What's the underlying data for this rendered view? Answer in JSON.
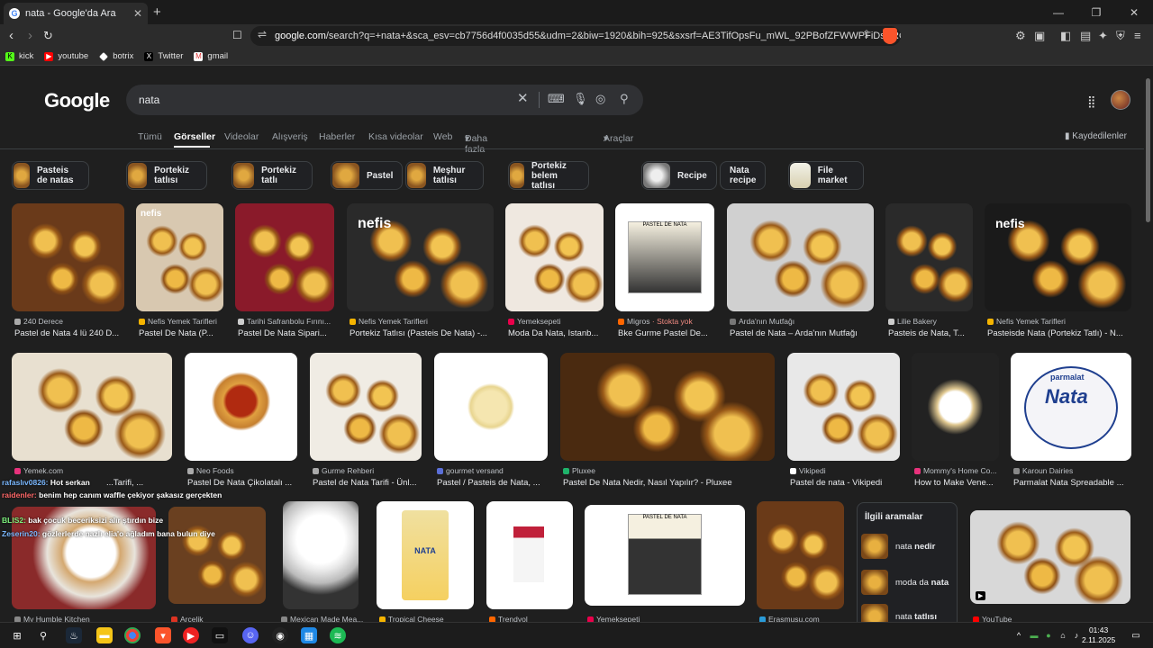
{
  "browser": {
    "tab_title": "nata - Google'da Ara",
    "url_prefix": "google.com",
    "url_rest": "/search?q=+nata+&sca_esv=cb7756d4f0035d55&udm=2&biw=1920&bih=925&sxsrf=AE3TifOpsFu_mWL_92PBofZFWWPFiDsKRQ%3A17620...",
    "bookmarks": [
      "kick",
      "youtube",
      "botrix",
      "Twitter",
      "gmail"
    ]
  },
  "google": {
    "logo": "Google",
    "query": "nata",
    "tabs": [
      "Tümü",
      "Görseller",
      "Videolar",
      "Alışveriş",
      "Haberler",
      "Kısa videolar",
      "Web",
      "Daha fazla",
      "Araçlar"
    ],
    "saved": "Kaydedilenler",
    "chips": [
      "Pasteis de natas",
      "Portekiz tatlısı",
      "Portekiz tatlı",
      "Pastel",
      "Meşhur tatlısı",
      "Portekiz belem tatlısı",
      "Recipe",
      "Nata recipe",
      "File market"
    ]
  },
  "row1": [
    {
      "source": "240 Derece",
      "title": "Pastel de Nata 4 lü 240 D..."
    },
    {
      "source": "Nefis Yemek Tarifleri",
      "title": "Pastel De Nata (P..."
    },
    {
      "source": "Tarihi Safranbolu Fırını...",
      "title": "Pastel De Nata Sipari..."
    },
    {
      "source": "Nefis Yemek Tarifleri",
      "title": "Portekiz Tatlısı (Pasteis De Nata) -..."
    },
    {
      "source": "Yemeksepeti",
      "title": "Moda Da Nata, Istanb..."
    },
    {
      "source": "Migros",
      "extra": "· Stokta yok",
      "title": "Bke Gurme Pastel De..."
    },
    {
      "source": "Arda'nın Mutfağı",
      "title": "Pastel de Nata – Arda'nın Mutfağı"
    },
    {
      "source": "Lilie Bakery",
      "title": "Pasteis de Nata, T..."
    },
    {
      "source": "Nefis Yemek Tarifleri",
      "title": "Pasteisde Nata (Portekiz Tatlı) - N..."
    }
  ],
  "row2": [
    {
      "source": "Yemek.com",
      "title": "...Tarifi, ..."
    },
    {
      "source": "Neo Foods",
      "title": "Pastel De Nata Çikolatalı ..."
    },
    {
      "source": "Gurme Rehberi",
      "title": "Pastel de Nata Tarifi - Ünl..."
    },
    {
      "source": "gourmet versand",
      "title": "Pastel / Pasteis de Nata, ..."
    },
    {
      "source": "Pluxee",
      "title": "Pastel De Nata Nedir, Nasıl Yapılır? - Pluxee"
    },
    {
      "source": "Vikipedi",
      "title": "Pastel de nata - Vikipedi"
    },
    {
      "source": "Mommy's Home Co...",
      "title": "How to Make Vene..."
    },
    {
      "source": "Karoun Dairies",
      "title": "Parmalat Nata Spreadable ..."
    }
  ],
  "row3_sources": [
    "My Humble Kitchen",
    "Arçelik",
    "Mexican Made Mea...",
    "Tropical Cheese",
    "Trendyol",
    "Yemeksepeti",
    "Erasmusu.com",
    "YouTube"
  ],
  "related": {
    "heading": "İlgili aramalar",
    "items": [
      {
        "pre": "nata",
        "bold": "nedir"
      },
      {
        "pre": "moda da",
        "bold": "nata"
      },
      {
        "pre": "nata",
        "bold": "tatlısı"
      }
    ]
  },
  "chat": [
    {
      "user": "rafaslıv0826:",
      "text": "Hot serkan"
    },
    {
      "user": "raidenler:",
      "text": "benim hep canım waffle çekiyor şakasız gerçekten"
    },
    {
      "user": "BLIS2:",
      "text": "bak çocuk beceriksizi alır ştırdın bize"
    },
    {
      "user": "Zeserin20:",
      "text": "gözlerlerde nazlı elia'o ağladım bana bulun diye"
    }
  ],
  "taskbar": {
    "time": "01:43",
    "date": "2.11.2025"
  },
  "image_labels": {
    "nefis": "nefis",
    "parmalat": "parmalat",
    "nata_brand": "Nata",
    "box_label": "PASTEL DE NATA",
    "nata_pack": "NATA"
  }
}
